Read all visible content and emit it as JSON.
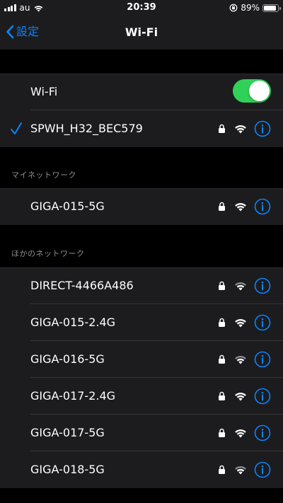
{
  "status_bar": {
    "carrier": "au",
    "time": "20:39",
    "battery_percent": "89%",
    "battery_level": 0.89,
    "icons": [
      "signal-bars-icon",
      "wifi-status-icon",
      "orientation-lock-icon",
      "battery-icon"
    ]
  },
  "nav": {
    "back_label": "設定",
    "title": "Wi-Fi"
  },
  "wifi_toggle": {
    "label": "Wi-Fi",
    "on": true
  },
  "connected": {
    "ssid": "SPWH_H32_BEC579",
    "locked": true,
    "signal": "full"
  },
  "my_networks": {
    "header": "マイネットワーク",
    "items": [
      {
        "ssid": "GIGA-015-5G",
        "locked": true,
        "signal": "full"
      }
    ]
  },
  "other_networks": {
    "header": "ほかのネットワーク",
    "items": [
      {
        "ssid": "DIRECT-4466A486",
        "locked": true,
        "signal": "weak"
      },
      {
        "ssid": "GIGA-015-2.4G",
        "locked": true,
        "signal": "full"
      },
      {
        "ssid": "GIGA-016-5G",
        "locked": true,
        "signal": "weak"
      },
      {
        "ssid": "GIGA-017-2.4G",
        "locked": true,
        "signal": "full"
      },
      {
        "ssid": "GIGA-017-5G",
        "locked": true,
        "signal": "full"
      },
      {
        "ssid": "GIGA-018-5G",
        "locked": true,
        "signal": "weak"
      }
    ]
  },
  "colors": {
    "accent": "#0a84ff",
    "toggle_on": "#30d158",
    "background": "#000000",
    "cell": "#1c1c1e",
    "secondary_text": "#8e8e93"
  }
}
